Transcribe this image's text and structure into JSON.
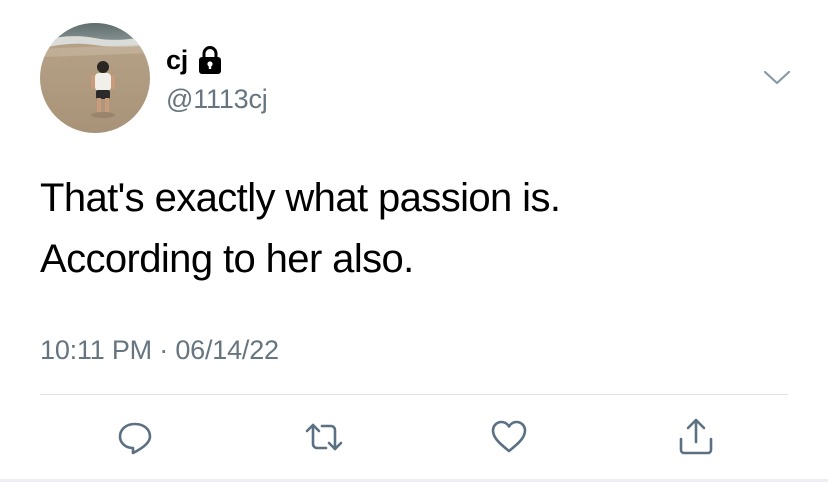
{
  "author": {
    "display_name": "cj",
    "handle": "@1113cj",
    "protected": true,
    "avatar_icon": "avatar-photo-child-on-beach"
  },
  "tweet": {
    "text_lines": [
      "That's exactly what passion is.",
      "According to her also."
    ],
    "timestamp": "10:11 PM · 06/14/22"
  },
  "actions": [
    {
      "name": "reply",
      "icon": "reply-icon"
    },
    {
      "name": "retweet",
      "icon": "retweet-icon"
    },
    {
      "name": "like",
      "icon": "heart-icon"
    },
    {
      "name": "share",
      "icon": "share-icon"
    }
  ],
  "colors": {
    "text_primary": "#000000",
    "text_secondary": "#66757f",
    "icon": "#5b7083",
    "divider": "#dfe3e6",
    "background": "#ffffff"
  }
}
